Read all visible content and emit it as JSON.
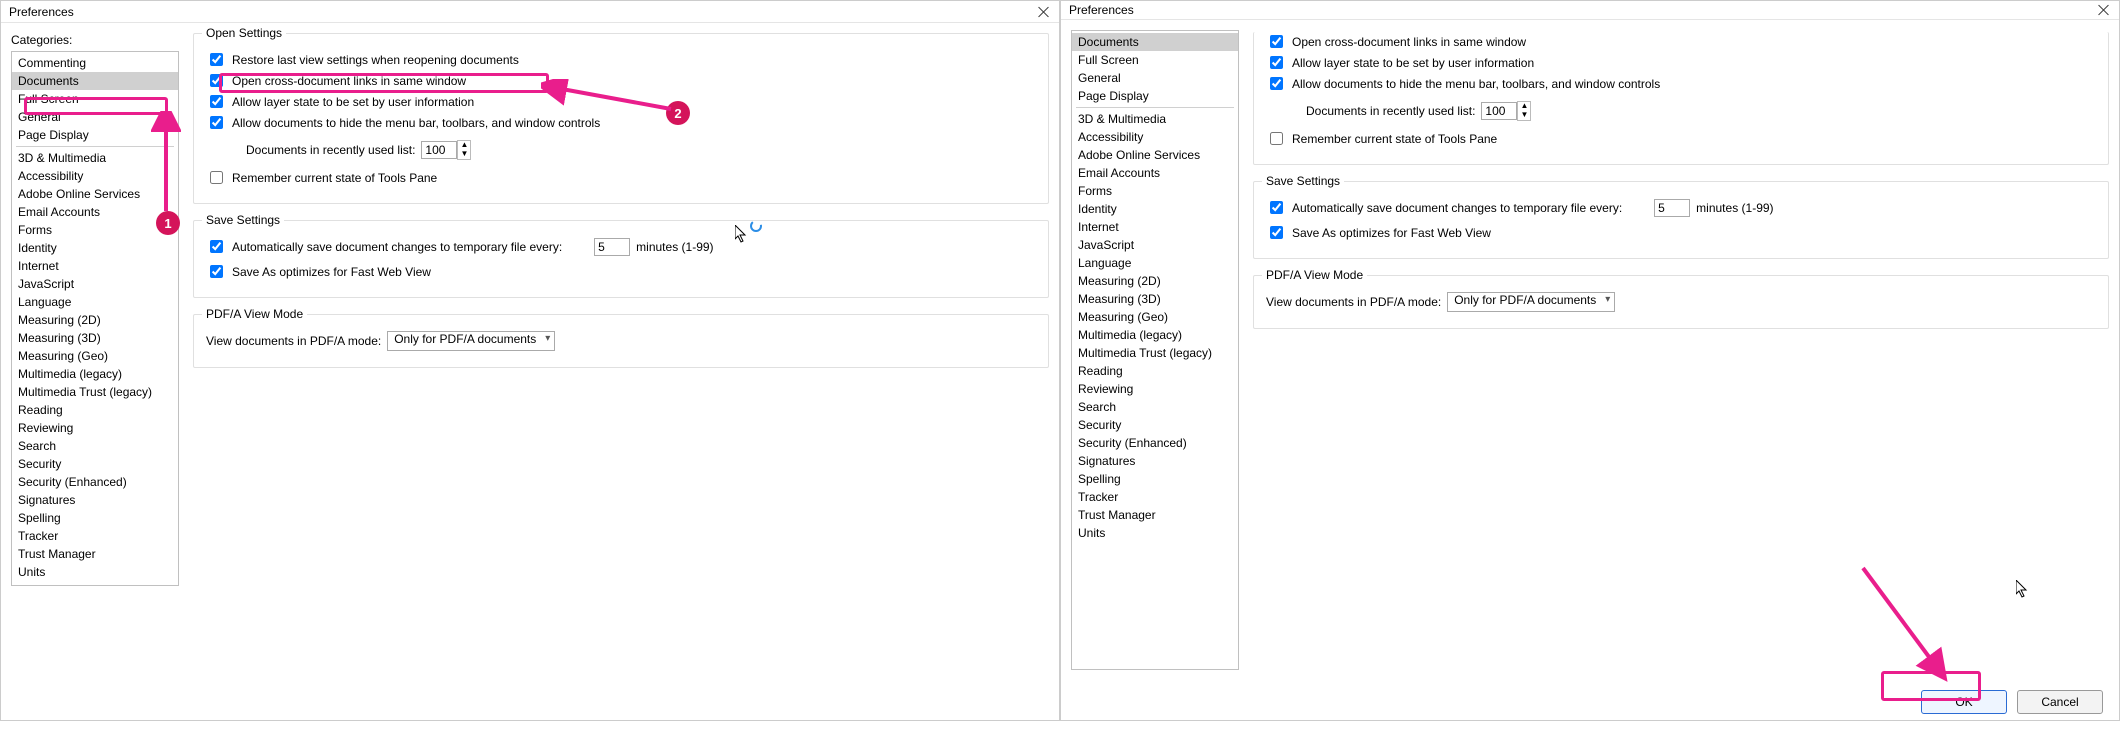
{
  "titles": {
    "prefs": "Preferences",
    "categories": "Categories:"
  },
  "cats_top": [
    "Commenting",
    "Documents",
    "Full Screen",
    "General",
    "Page Display"
  ],
  "cats_bottom": [
    "3D & Multimedia",
    "Accessibility",
    "Adobe Online Services",
    "Email Accounts",
    "Forms",
    "Identity",
    "Internet",
    "JavaScript",
    "Language",
    "Measuring (2D)",
    "Measuring (3D)",
    "Measuring (Geo)",
    "Multimedia (legacy)",
    "Multimedia Trust (legacy)",
    "Reading",
    "Reviewing",
    "Search",
    "Security",
    "Security (Enhanced)",
    "Signatures",
    "Spelling",
    "Tracker",
    "Trust Manager",
    "Units"
  ],
  "open": {
    "title": "Open Settings",
    "restore": "Restore last view settings when reopening documents",
    "crosslinks": "Open cross-document links in same window",
    "layer": "Allow layer state to be set by user information",
    "hidemenu": "Allow documents to hide the menu bar, toolbars, and window controls",
    "recents_label": "Documents in recently used list:",
    "recents_val": "100",
    "remember_tools": "Remember current state of Tools Pane"
  },
  "save": {
    "title": "Save Settings",
    "autosave": "Automatically save document changes to temporary file every:",
    "minutes_val": "5",
    "minutes_suffix": "minutes (1-99)",
    "fastweb": "Save As optimizes for Fast Web View"
  },
  "pdfa": {
    "title": "PDF/A View Mode",
    "label": "View documents in PDF/A mode:",
    "value": "Only for PDF/A documents"
  },
  "buttons": {
    "ok": "OK",
    "cancel": "Cancel"
  },
  "badges": {
    "b1": "1",
    "b2": "2"
  }
}
